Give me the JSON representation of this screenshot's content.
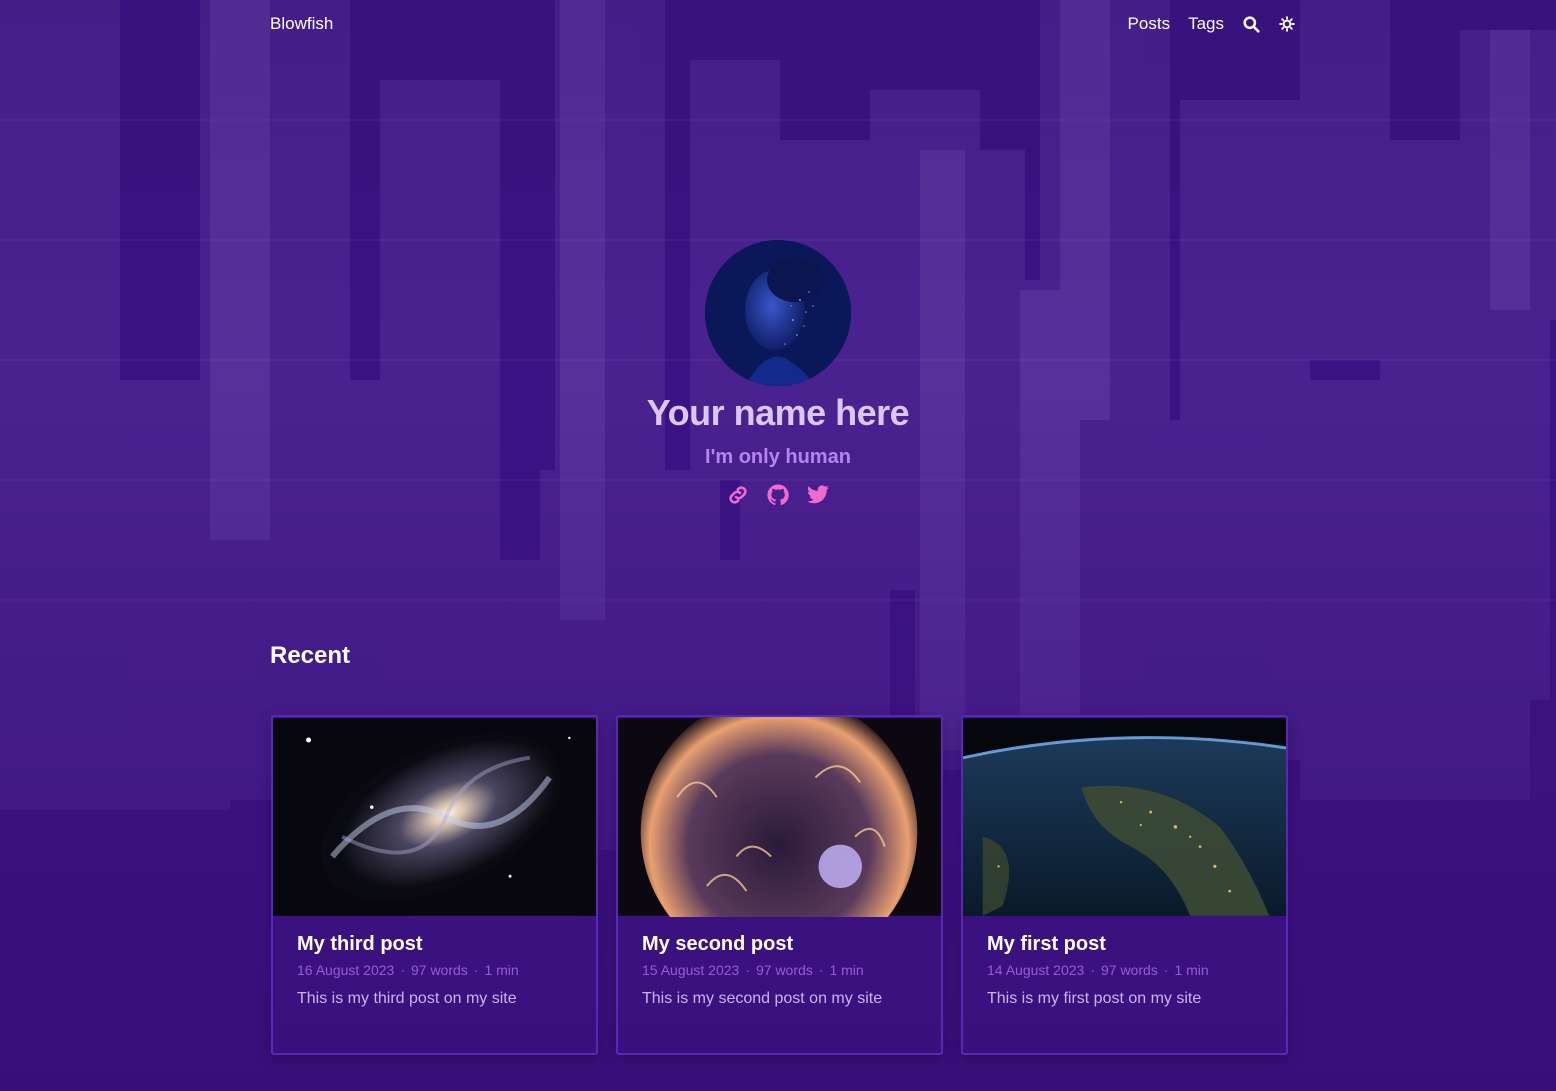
{
  "nav": {
    "brand": "Blowfish",
    "links": [
      "Posts",
      "Tags"
    ]
  },
  "icons": {
    "search": "search-icon",
    "theme": "theme-toggle-icon",
    "link": "link-icon",
    "github": "github-icon",
    "twitter": "twitter-icon"
  },
  "hero": {
    "name": "Your name here",
    "subtitle": "I'm only human"
  },
  "recent": {
    "heading": "Recent",
    "posts": [
      {
        "title": "My third post",
        "date": "16 August 2023",
        "words": "97 words",
        "reading": "1 min",
        "summary": "This is my third post on my site"
      },
      {
        "title": "My second post",
        "date": "15 August 2023",
        "words": "97 words",
        "reading": "1 min",
        "summary": "This is my second post on my site"
      },
      {
        "title": "My first post",
        "date": "14 August 2023",
        "words": "97 words",
        "reading": "1 min",
        "summary": "This is my first post on my site"
      }
    ]
  },
  "colors": {
    "accent": "#b684f0",
    "name": "#dcc6f2",
    "social": "#f06ad0",
    "background": "#3a1480"
  }
}
